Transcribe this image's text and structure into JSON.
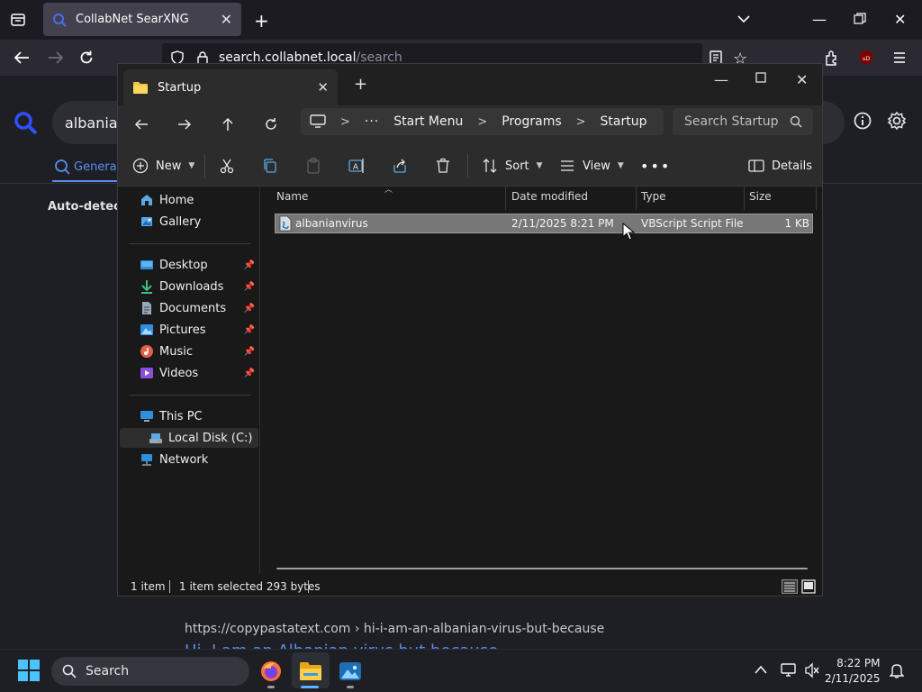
{
  "browser": {
    "tab_title": "CollabNet SearXNG",
    "url_domain": "search.collabnet.local",
    "url_path": "/search",
    "search_query": "albanian",
    "category_tab": "General",
    "autodetect_label": "Auto-detect (",
    "result_url": "https://copypastatext.com  › hi-i-am-an-albanian-virus-but-because",
    "result_title": "Hi, I am an Albanian virus but because"
  },
  "explorer": {
    "tab_title": "Startup",
    "breadcrumb": [
      "Start Menu",
      "Programs",
      "Startup"
    ],
    "search_placeholder": "Search Startup",
    "commands": {
      "new": "New",
      "sort": "Sort",
      "view": "View",
      "details": "Details"
    },
    "nav": {
      "home": "Home",
      "gallery": "Gallery",
      "desktop": "Desktop",
      "downloads": "Downloads",
      "documents": "Documents",
      "pictures": "Pictures",
      "music": "Music",
      "videos": "Videos",
      "this_pc": "This PC",
      "local_disk": "Local Disk (C:)",
      "network": "Network"
    },
    "columns": {
      "name": "Name",
      "date": "Date modified",
      "type": "Type",
      "size": "Size"
    },
    "files": [
      {
        "name": "albanianvirus",
        "date": "2/11/2025 8:21 PM",
        "type": "VBScript Script File",
        "size": "1 KB"
      }
    ],
    "status": {
      "count": "1 item",
      "selection": "1 item selected  293 bytes"
    }
  },
  "taskbar": {
    "search_label": "Search",
    "time": "8:22 PM",
    "date": "2/11/2025"
  }
}
